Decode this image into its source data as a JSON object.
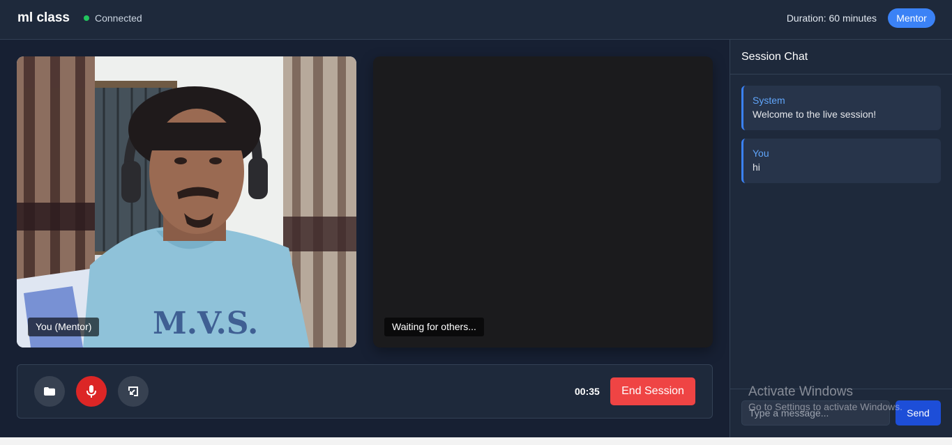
{
  "header": {
    "title": "ml class",
    "status": "Connected",
    "duration": "Duration: 60 minutes",
    "role": "Mentor"
  },
  "videos": {
    "local_label": "You (Mentor)",
    "remote_label": "Waiting for others..."
  },
  "controls": {
    "icons": [
      "video-icon",
      "microphone-icon",
      "screen-share-icon"
    ],
    "timer": "00:35",
    "end_label": "End Session"
  },
  "chat": {
    "title": "Session Chat",
    "messages": [
      {
        "author": "System",
        "text": "Welcome to the live session!"
      },
      {
        "author": "You",
        "text": "hi"
      }
    ],
    "input_placeholder": "Type a message...",
    "send_label": "Send"
  },
  "watermark": {
    "title": "Activate Windows",
    "subtitle": "Go to Settings to activate Windows."
  },
  "colors": {
    "accent": "#3b82f6",
    "danger": "#ef4444",
    "mic_active": "#dc2626",
    "connected": "#22c55e"
  }
}
